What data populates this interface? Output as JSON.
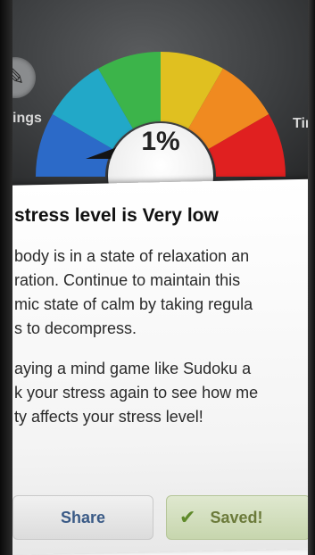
{
  "toolbar": {
    "left_label": "ings",
    "right_label": "Tin",
    "left_icon": "wrench-icon"
  },
  "gauge": {
    "value_text": "1%",
    "level": 0.01,
    "colors": [
      "#2c6ac8",
      "#22a8c8",
      "#3cb44a",
      "#e0c020",
      "#f08a20",
      "#e02020"
    ]
  },
  "result": {
    "headline": "stress level is Very low",
    "paragraph1": [
      "body is in a state of relaxation an",
      "ration. Continue to maintain this",
      "mic state of calm by taking regula",
      "s to decompress."
    ],
    "paragraph2": [
      "aying a mind game like Sudoku a",
      "k your stress again to see how me",
      "ty affects your stress level!"
    ]
  },
  "buttons": {
    "share_label": "Share",
    "saved_label": "Saved!"
  }
}
